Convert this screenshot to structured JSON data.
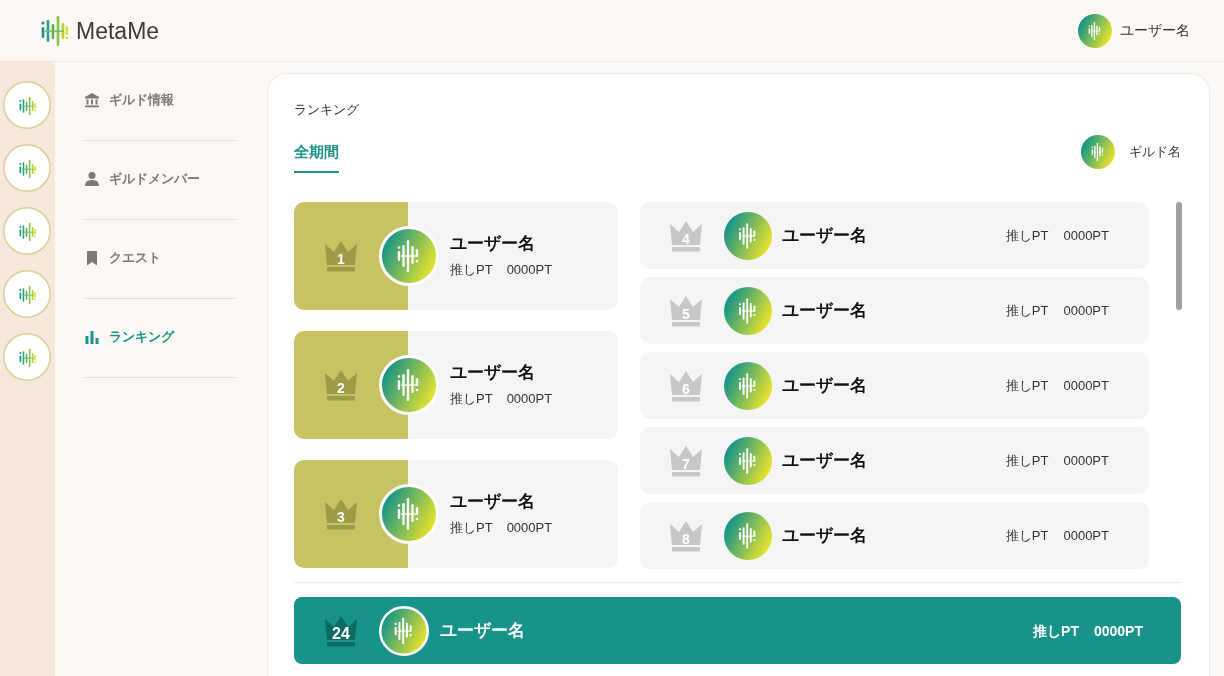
{
  "header": {
    "logo": "MetaMe",
    "user_name": "ユーザー名"
  },
  "sidebar": {
    "items": [
      {
        "label": "ギルド情報",
        "kind": "building",
        "selected": false
      },
      {
        "label": "ギルドメンバー",
        "kind": "person",
        "selected": false
      },
      {
        "label": "クエスト",
        "kind": "bookmark",
        "selected": false
      },
      {
        "label": "ランキング",
        "kind": "chart",
        "selected": true
      }
    ]
  },
  "ranking": {
    "title": "ランキング",
    "tabs": [
      {
        "label": "全期間",
        "selected": true
      }
    ],
    "guild_name": "ギルド名",
    "top_entries": [
      {
        "rank": "1",
        "name": "ユーザー名",
        "points_label": "推しPT",
        "points": "0000PT"
      },
      {
        "rank": "2",
        "name": "ユーザー名",
        "points_label": "推しPT",
        "points": "0000PT"
      },
      {
        "rank": "3",
        "name": "ユーザー名",
        "points_label": "推しPT",
        "points": "0000PT"
      }
    ],
    "entries": [
      {
        "rank": "4",
        "name": "ユーザー名",
        "points_label": "推しPT",
        "points": "0000PT"
      },
      {
        "rank": "5",
        "name": "ユーザー名",
        "points_label": "推しPT",
        "points": "0000PT"
      },
      {
        "rank": "6",
        "name": "ユーザー名",
        "points_label": "推しPT",
        "points": "0000PT"
      },
      {
        "rank": "7",
        "name": "ユーザー名",
        "points_label": "推しPT",
        "points": "0000PT"
      },
      {
        "rank": "8",
        "name": "ユーザー名",
        "points_label": "推しPT",
        "points": "0000PT"
      }
    ],
    "my_entry": {
      "rank": "24",
      "name": "ユーザー名",
      "points_label": "推しPT",
      "points": "0000PT"
    }
  }
}
